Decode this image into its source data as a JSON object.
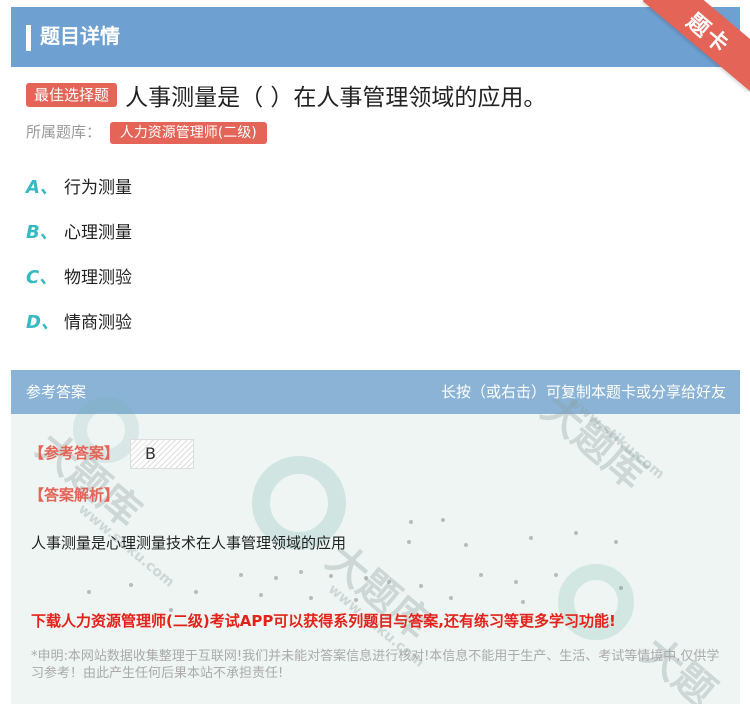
{
  "header": {
    "title": "题目详情",
    "ribbon": "题卡"
  },
  "question": {
    "badge": "最佳选择题",
    "text": "人事测量是（  ）在人事管理领域的应用。",
    "source_label": "所属题库：",
    "source_tag": "人力资源管理师(二级)"
  },
  "options": [
    {
      "letter": "A、",
      "text": "行为测量"
    },
    {
      "letter": "B、",
      "text": "心理测量"
    },
    {
      "letter": "C、",
      "text": "物理测验"
    },
    {
      "letter": "D、",
      "text": "情商测验"
    }
  ],
  "answer": {
    "head_left": "参考答案",
    "head_right": "长按（或右击）可复制本题卡或分享给好友",
    "answer_label": "【参考答案】",
    "answer_value": "B",
    "analysis_label": "【答案解析】",
    "analysis_text": "人事测量是心理测量技术在人事管理领域的应用",
    "promo": "下载人力资源管理师(二级)考试APP可以获得系列题目与答案,还有练习等更多学习功能!",
    "disclaimer": "*申明:本网站数据收集整理于互联网!我们并未能对答案信息进行核对!本信息不能用于生产、生活、考试等情境中,仅供学习参考！由此产生任何后果本站不承担责任!"
  },
  "watermarks": [
    "大题库",
    "www.stiku.com",
    "大题库",
    "www.stiku.com",
    "大题库",
    "www.stiku.com",
    "大题"
  ],
  "colors": {
    "header": "#6fa0d2",
    "accent_red": "#e46458",
    "option_letter": "#35b9c2",
    "panel_bg": "#eef5f3"
  }
}
